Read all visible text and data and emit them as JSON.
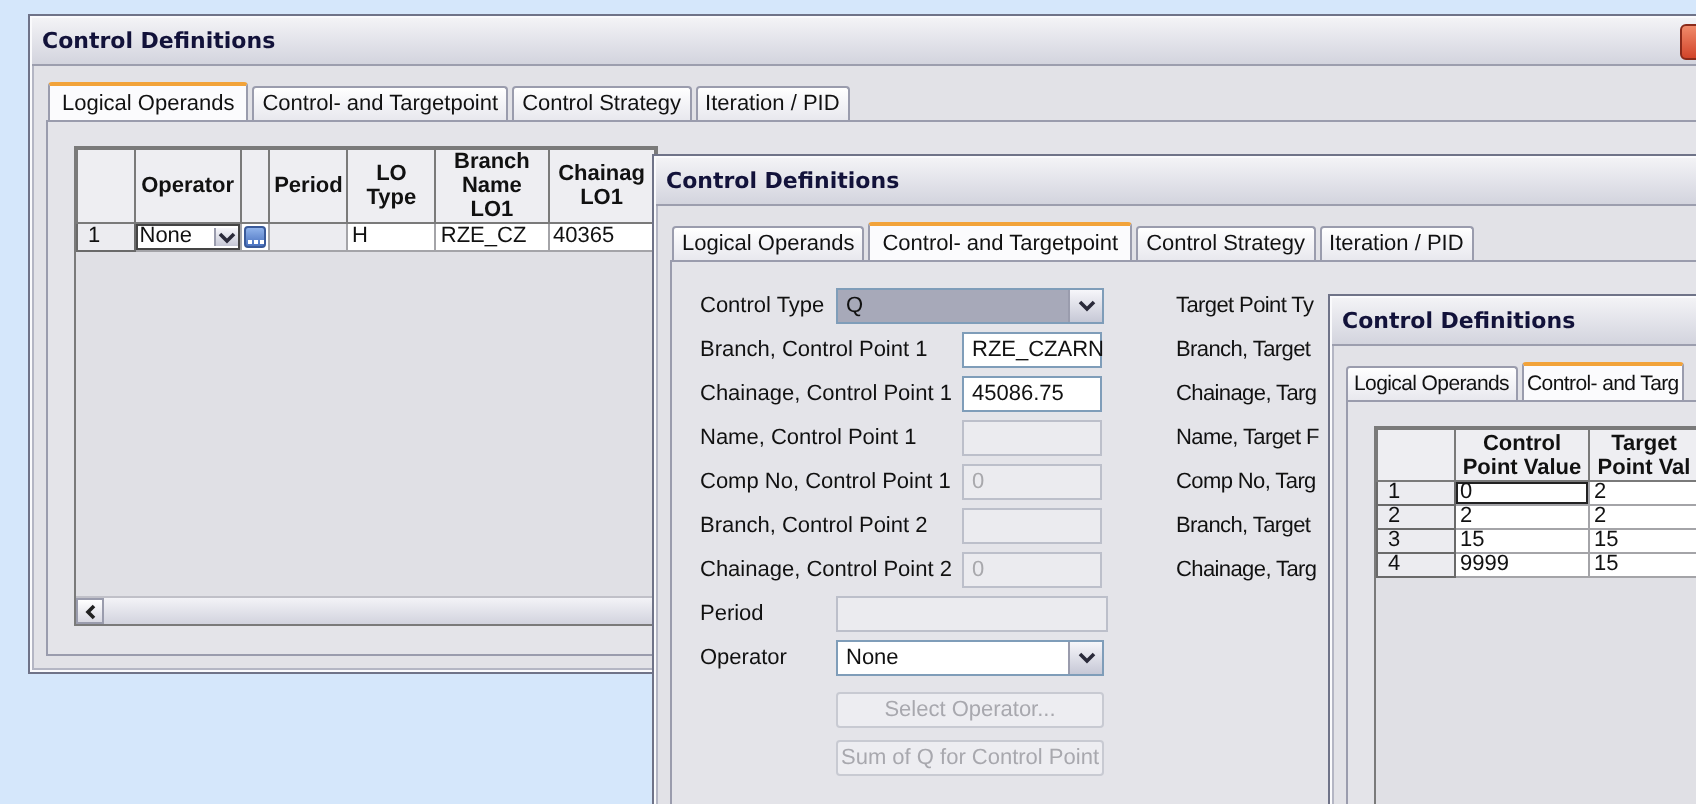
{
  "windows": [
    {
      "kind": "operands",
      "title": "Control Definitions",
      "close_visible": true,
      "tabs": [
        {
          "label": "Logical Operands",
          "selected": true
        },
        {
          "label": "Control- and Targetpoint",
          "selected": false
        },
        {
          "label": "Control Strategy",
          "selected": false
        },
        {
          "label": "Iteration / PID",
          "selected": false
        }
      ],
      "grid": {
        "columns": [
          {
            "kind": "rownum"
          },
          {
            "kind": "text",
            "label": "Operator"
          },
          {
            "kind": "button"
          },
          {
            "kind": "text",
            "label": "Period"
          },
          {
            "kind": "text",
            "label": "LO Type"
          },
          {
            "kind": "text",
            "label": "Branch\nName LO1"
          },
          {
            "kind": "text",
            "label": "Chainag\nLO1"
          }
        ],
        "rows": [
          {
            "selected": false,
            "cells": [
              {
                "kind": "rownum",
                "value": "1"
              },
              {
                "kind": "combo",
                "value": "None"
              },
              {
                "kind": "button"
              },
              {
                "kind": "empty"
              },
              {
                "kind": "text",
                "value": "H"
              },
              {
                "kind": "text",
                "value": "RZE_CZ"
              },
              {
                "kind": "text",
                "value": "40365"
              }
            ]
          }
        ]
      }
    },
    {
      "kind": "targetpoint",
      "title": "Control Definitions",
      "tabs": [
        {
          "label": "Logical Operands",
          "selected": false
        },
        {
          "label": "Control- and Targetpoint",
          "selected": true
        },
        {
          "label": "Control Strategy",
          "selected": false
        },
        {
          "label": "Iteration / PID",
          "selected": false
        }
      ],
      "fields": [
        {
          "label": "Control Type",
          "kind": "combo",
          "value": "Q",
          "focused": true,
          "disabled": false
        },
        {
          "label": "Branch, Control Point 1",
          "kind": "text",
          "value": "RZE_CZARN",
          "disabled": false
        },
        {
          "label": "Chainage, Control Point 1",
          "kind": "text",
          "value": "45086.75",
          "disabled": false
        },
        {
          "label": "Name, Control Point 1",
          "kind": "text",
          "disabled": true
        },
        {
          "label": "Comp No, Control Point 1",
          "kind": "text",
          "value": "0",
          "disabled": true
        },
        {
          "label": "Branch, Control Point 2",
          "kind": "text",
          "disabled": true
        },
        {
          "label": "Chainage, Control Point 2",
          "kind": "text",
          "value": "0",
          "disabled": true
        },
        {
          "label": "Period",
          "kind": "wide",
          "disabled": true
        },
        {
          "label": "Operator",
          "kind": "combo",
          "value": "None",
          "focused": false,
          "disabled": false
        }
      ],
      "buttons": [
        {
          "label": "Select Operator...",
          "disabled": true
        },
        {
          "label": "Sum of Q for Control Point",
          "disabled": true
        }
      ],
      "right_labels": [
        "Target Point Ty",
        "Branch, Target",
        "Chainage, Targ",
        "Name, Target F",
        "Comp No, Targ",
        "Branch, Target",
        "Chainage, Targ"
      ]
    },
    {
      "kind": "values",
      "title": "Control Definitions",
      "tabs": [
        {
          "label": "Logical Operands",
          "selected": false
        },
        {
          "label": "Control- and Targ",
          "selected": true
        }
      ],
      "grid": {
        "columns": [
          {
            "kind": "rownum"
          },
          {
            "kind": "text",
            "label": "Control\nPoint Value"
          },
          {
            "kind": "text",
            "label": "Target\nPoint Val"
          }
        ],
        "rows": [
          {
            "selected": true,
            "cells": [
              {
                "kind": "rownum",
                "value": "1"
              },
              {
                "kind": "text",
                "value": "0"
              },
              {
                "kind": "text",
                "value": "2"
              }
            ]
          },
          {
            "selected": false,
            "cells": [
              {
                "kind": "rownum",
                "value": "2"
              },
              {
                "kind": "text",
                "value": "2"
              },
              {
                "kind": "text",
                "value": "2"
              }
            ]
          },
          {
            "selected": false,
            "cells": [
              {
                "kind": "rownum",
                "value": "3"
              },
              {
                "kind": "text",
                "value": "15"
              },
              {
                "kind": "text",
                "value": "15"
              }
            ]
          },
          {
            "selected": false,
            "cells": [
              {
                "kind": "rownum",
                "value": "4"
              },
              {
                "kind": "text",
                "value": "9999"
              },
              {
                "kind": "text",
                "value": "15"
              }
            ]
          }
        ]
      }
    }
  ]
}
